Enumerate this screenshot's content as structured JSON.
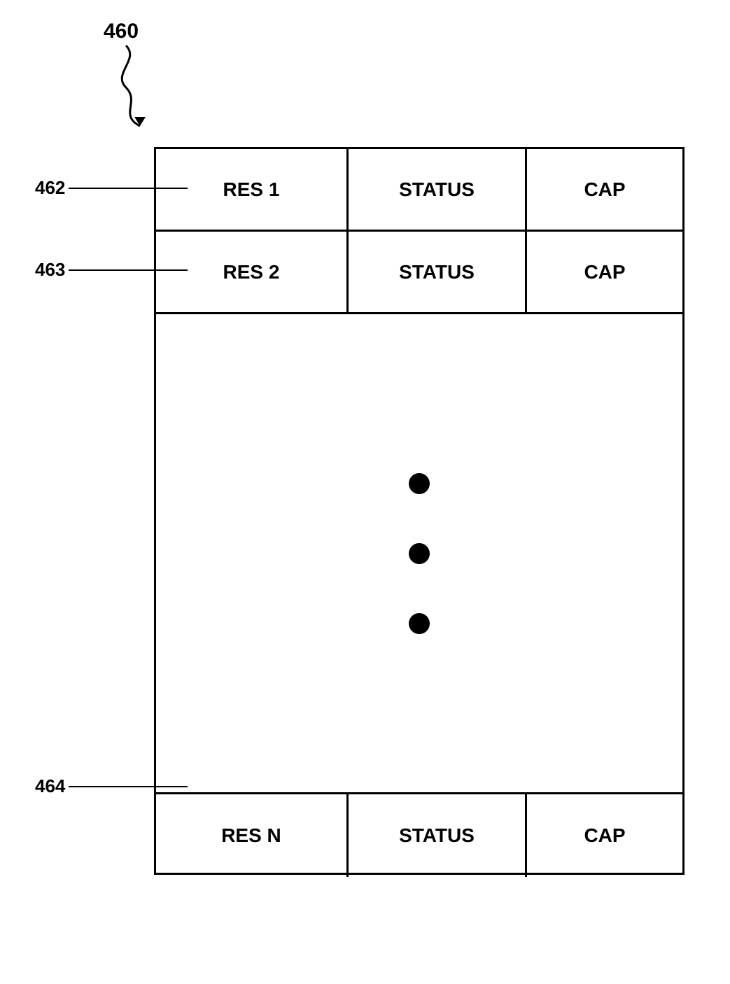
{
  "labels": {
    "460": "460",
    "462": "462",
    "463": "463",
    "464": "464"
  },
  "rows": {
    "row1": {
      "res": "RES 1",
      "status": "STATUS",
      "cap": "CAP"
    },
    "row2": {
      "res": "RES 2",
      "status": "STATUS",
      "cap": "CAP"
    },
    "rowN": {
      "res": "RES N",
      "status": "STATUS",
      "cap": "CAP"
    }
  },
  "dots": [
    "•",
    "•",
    "•"
  ]
}
